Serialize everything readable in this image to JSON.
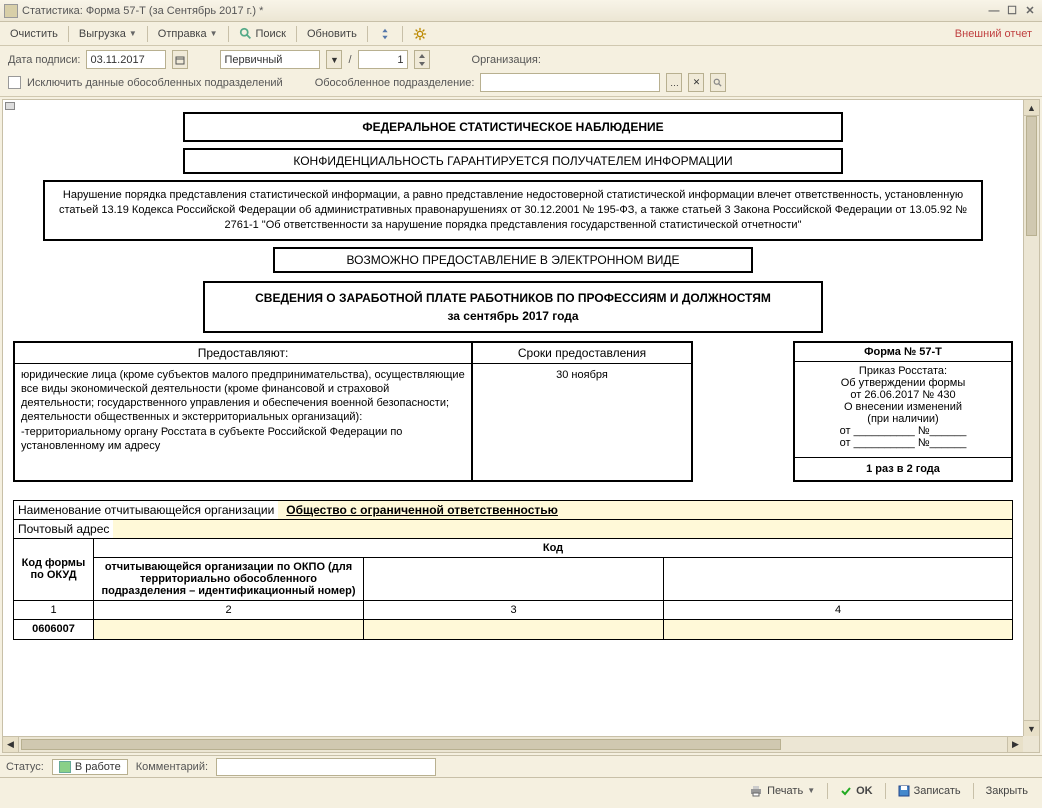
{
  "window": {
    "title": "Статистика: Форма 57-Т (за Сентябрь 2017 г.) *"
  },
  "toolbar": {
    "clear": "Очистить",
    "export": "Выгрузка",
    "send": "Отправка",
    "search": "Поиск",
    "refresh": "Обновить",
    "ext_report": "Внешний отчет"
  },
  "params": {
    "date_label": "Дата подписи:",
    "date_value": "03.11.2017",
    "type_value": "Первичный",
    "slash": "/",
    "num_value": "1",
    "org_label": "Организация:",
    "exclude_label": "Исключить данные обособленных подразделений",
    "subdiv_label": "Обособленное подразделение:"
  },
  "doc": {
    "banner1": "ФЕДЕРАЛЬНОЕ СТАТИСТИЧЕСКОЕ НАБЛЮДЕНИЕ",
    "banner2": "КОНФИДЕНЦИАЛЬНОСТЬ ГАРАНТИРУЕТСЯ ПОЛУЧАТЕЛЕМ ИНФОРМАЦИИ",
    "banner3": "Нарушение порядка представления статистической информации, а равно представление недостоверной статистической информации влечет ответственность, установленную статьей 13.19 Кодекса Российской Федерации об административных правонарушениях от 30.12.2001 № 195-ФЗ, а также статьей 3 Закона Российской Федерации от 13.05.92 № 2761-1 \"Об ответственности за нарушение порядка представления государственной статистической отчетности\"",
    "banner4": "ВОЗМОЖНО ПРЕДОСТАВЛЕНИЕ В ЭЛЕКТРОННОМ ВИДЕ",
    "title1": "СВЕДЕНИЯ О ЗАРАБОТНОЙ ПЛАТЕ РАБОТНИКОВ ПО ПРОФЕССИЯМ И ДОЛЖНОСТЯМ",
    "title2": "за сентябрь 2017 года",
    "meta": {
      "provide_hdr": "Предоставляют:",
      "deadline_hdr": "Сроки предоставления",
      "provide_body": "юридические лица (кроме субъектов малого предпринимательства), осуществляющие все виды экономической деятельности (кроме финансовой и страховой деятельности; государственного управления и обеспечения военной безопасности; деятельности общественных и экстерриториальных организаций):\n  -территориальному органу Росстата в субъекте Российской Федерации по установленному им адресу",
      "deadline_body": "30 ноября",
      "form_hdr": "Форма № 57-Т",
      "form_order": "Приказ Росстата:\nОб утверждении формы\nот 26.06.2017 № 430\nО внесении изменений\n(при наличии)\nот __________ №______\nот __________ №______",
      "form_period": "1 раз в 2 года"
    },
    "org_name_lbl": "Наименование отчитывающейся организации",
    "org_name_val": "Общество с ограниченной ответственностью",
    "addr_lbl": "Почтовый адрес",
    "code_hdr": "Код",
    "okud_lbl": "Код формы по ОКУД",
    "okpo_lbl": "отчитывающейся организации по ОКПО (для территориально обособленного подразделения – идентификационный номер)",
    "col1": "1",
    "col2": "2",
    "col3": "3",
    "col4": "4",
    "okud_val": "0606007"
  },
  "status": {
    "label": "Статус:",
    "value": "В работе",
    "comment_label": "Комментарий:"
  },
  "bottom": {
    "print": "Печать",
    "ok": "OK",
    "save": "Записать",
    "close": "Закрыть"
  }
}
